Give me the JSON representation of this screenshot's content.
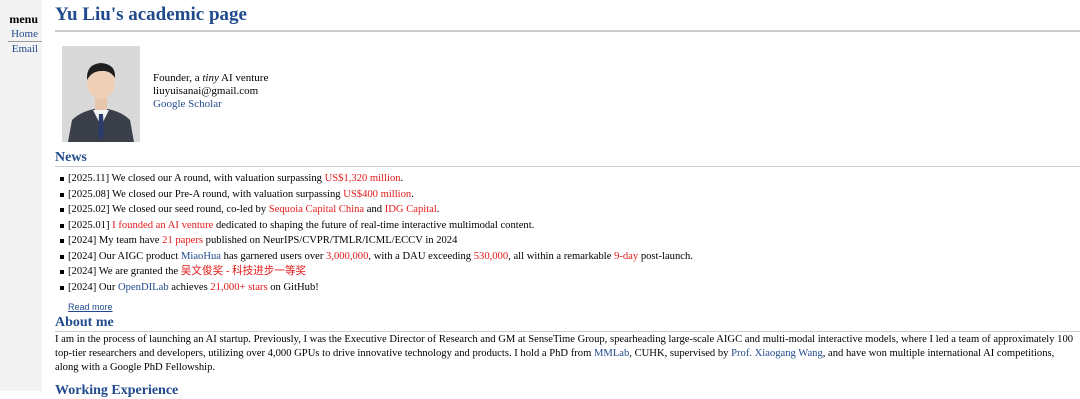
{
  "menu": {
    "title": "menu",
    "items": [
      {
        "label": "Home"
      },
      {
        "label": "Email"
      }
    ]
  },
  "page": {
    "title": "Yu Liu's academic page"
  },
  "profile": {
    "line1_prefix": "Founder, a ",
    "line1_em": "tiny",
    "line1_suffix": " AI venture",
    "email": "liuyuisanai@gmail.com",
    "scholar": "Google Scholar"
  },
  "news": {
    "heading": "News",
    "items": [
      {
        "parts": [
          {
            "t": "[2025.11] We closed our A round, with valuation surpassing "
          },
          {
            "t": "US$1,320 million",
            "c": "hl"
          },
          {
            "t": "."
          }
        ]
      },
      {
        "parts": [
          {
            "t": "[2025.08] We closed our Pre-A round, with valuation surpassing "
          },
          {
            "t": "US$400 million",
            "c": "hl"
          },
          {
            "t": "."
          }
        ]
      },
      {
        "parts": [
          {
            "t": "[2025.02] We closed our seed round, co-led by "
          },
          {
            "t": "Sequoia Capital China",
            "c": "hl"
          },
          {
            "t": " and "
          },
          {
            "t": "IDG Capital",
            "c": "hl"
          },
          {
            "t": "."
          }
        ]
      },
      {
        "parts": [
          {
            "t": "[2025.01] "
          },
          {
            "t": "I founded an AI venture",
            "c": "hl"
          },
          {
            "t": " dedicated to shaping the future of real-time interactive multimodal content."
          }
        ]
      },
      {
        "parts": [
          {
            "t": "[2024] My team have "
          },
          {
            "t": "21 papers",
            "c": "hl"
          },
          {
            "t": " published on NeurIPS/CVPR/TMLR/ICML/ECCV in 2024"
          }
        ]
      },
      {
        "parts": [
          {
            "t": "[2024] Our AIGC product "
          },
          {
            "t": "MiaoHua",
            "c": "lk"
          },
          {
            "t": " has garnered users over "
          },
          {
            "t": "3,000,000",
            "c": "hl"
          },
          {
            "t": ", with a DAU exceeding "
          },
          {
            "t": "530,000",
            "c": "hl"
          },
          {
            "t": ", all within a remarkable "
          },
          {
            "t": "9-day",
            "c": "hl"
          },
          {
            "t": " post-launch."
          }
        ]
      },
      {
        "parts": [
          {
            "t": "[2024] We are granted the "
          },
          {
            "t": "吴文俊奖 - 科技进步一等奖",
            "c": "hl"
          }
        ]
      },
      {
        "parts": [
          {
            "t": "[2024] Our "
          },
          {
            "t": "OpenDILab",
            "c": "lk"
          },
          {
            "t": " achieves "
          },
          {
            "t": "21,000+ stars",
            "c": "hl"
          },
          {
            "t": " on GitHub!"
          }
        ]
      }
    ],
    "read_more": "Read more"
  },
  "about": {
    "heading": "About me",
    "parts": [
      {
        "t": "I am in the process of launching an AI startup. Previously, I was the Executive Director of Research and GM at SenseTime Group, spearheading large-scale AIGC and multi-modal interactive models, where I led a team of approximately 100 top-tier researchers and developers, utilizing over 4,000 GPUs to drive innovative technology and products. I hold a PhD from "
      },
      {
        "t": "MMLab",
        "c": "lk"
      },
      {
        "t": ", CUHK, supervised by "
      },
      {
        "t": "Prof. Xiaogang Wang",
        "c": "lk"
      },
      {
        "t": ", and have won multiple international AI competitions, along with a Google PhD Fellowship."
      }
    ]
  },
  "next_section": {
    "heading": "Working Experience"
  },
  "colors": {
    "accent": "#224b8d",
    "highlight": "#e41a1a",
    "menu_bg": "#f3f3f3"
  }
}
